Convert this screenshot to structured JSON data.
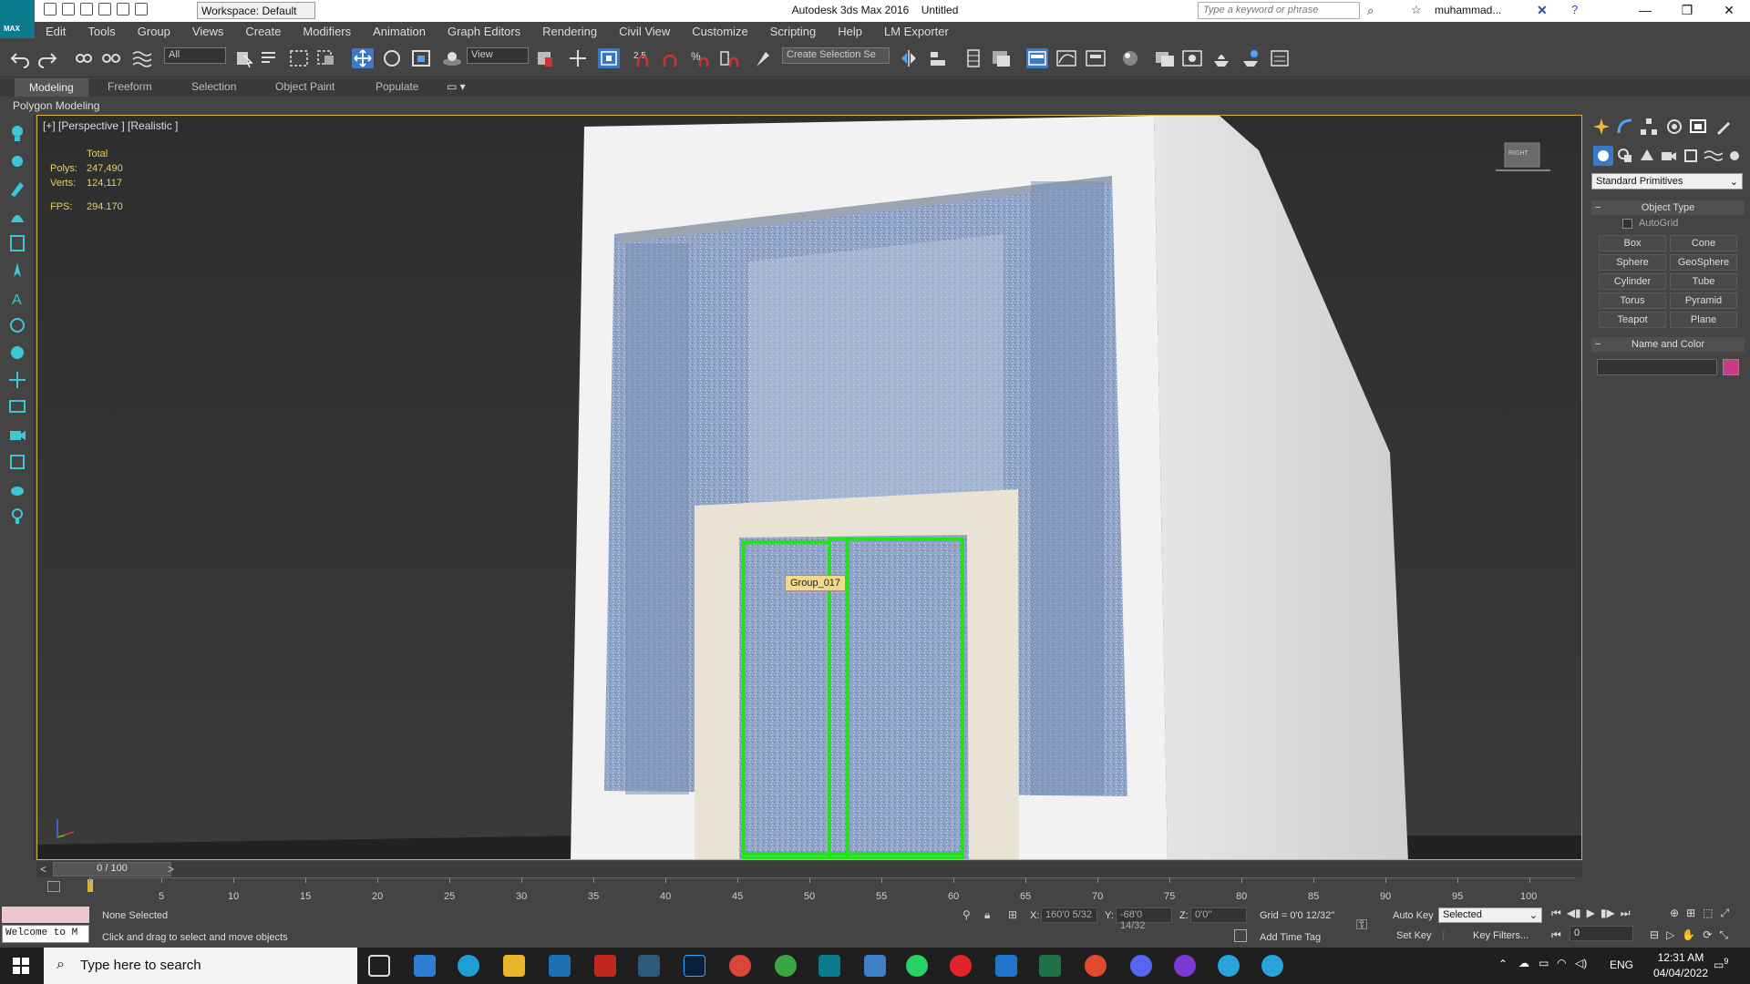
{
  "titlebar": {
    "logo_label": "MAX",
    "workspace": "Workspace: Default",
    "app_title": "Autodesk 3ds Max 2016",
    "document": "Untitled",
    "search_placeholder": "Type a keyword or phrase",
    "user": "muhammad...",
    "minimize": "—",
    "restore": "❐",
    "close": "✕"
  },
  "menu": [
    "Edit",
    "Tools",
    "Group",
    "Views",
    "Create",
    "Modifiers",
    "Animation",
    "Graph Editors",
    "Rendering",
    "Civil View",
    "Customize",
    "Scripting",
    "Help",
    "LM Exporter"
  ],
  "toolbar": {
    "selection_filter": "All",
    "reference_coord": "View",
    "snap_value": "2.5",
    "named_selection": "Create Selection Se"
  },
  "ribbon": {
    "tabs": [
      "Modeling",
      "Freeform",
      "Selection",
      "Object Paint",
      "Populate"
    ],
    "active_tab": "Modeling",
    "panel_label": "Polygon Modeling"
  },
  "viewport": {
    "label": "[+] [Perspective ] [Realistic ]",
    "stats": {
      "total_label": "Total",
      "polys_label": "Polys:",
      "polys": "247,490",
      "verts_label": "Verts:",
      "verts": "124,117",
      "fps_label": "FPS:",
      "fps": "294.170"
    },
    "tooltip": "Group_017",
    "viewcube_label": "RIGHT"
  },
  "command_panel": {
    "category": "Standard Primitives",
    "object_type_title": "Object Type",
    "autogrid": "AutoGrid",
    "buttons": [
      "Box",
      "Cone",
      "Sphere",
      "GeoSphere",
      "Cylinder",
      "Tube",
      "Torus",
      "Pyramid",
      "Teapot",
      "Plane"
    ],
    "name_color_title": "Name and Color",
    "object_color": "#c83a8c"
  },
  "timeline": {
    "frame_display": "0 / 100",
    "prev": "<",
    "next": ">",
    "ticks": [
      "5",
      "10",
      "15",
      "20",
      "25",
      "30",
      "35",
      "40",
      "45",
      "50",
      "55",
      "60",
      "65",
      "70",
      "75",
      "80",
      "85",
      "90",
      "95",
      "100"
    ]
  },
  "status": {
    "welcome": "Welcome to M",
    "selection": "None Selected",
    "prompt": "Click and drag to select and move objects",
    "x_label": "X:",
    "x_value": "160'0 5/32",
    "y_label": "Y:",
    "y_value": "-68'0 14/32",
    "z_label": "Z:",
    "z_value": "0'0\"",
    "grid": "Grid = 0'0 12/32\"",
    "add_time_tag": "Add Time Tag",
    "auto_key": "Auto Key",
    "auto_key_mode": "Selected",
    "set_key": "Set Key",
    "key_filters": "Key Filters...",
    "frame_value": "0"
  },
  "taskbar": {
    "search": "Type here to search",
    "lang": "ENG",
    "time": "12:31 AM",
    "date": "04/04/2022",
    "notification_count": "9"
  },
  "colors": {
    "viewport_border": "#d8b43e",
    "selection_green": "#27e020",
    "stats_yellow": "#e8d25a"
  }
}
